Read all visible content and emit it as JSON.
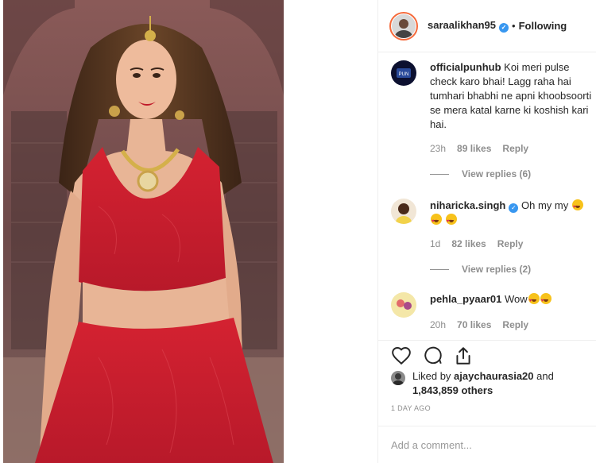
{
  "post": {
    "username": "saraalikhan95",
    "dot": "•",
    "follow_status": "Following"
  },
  "comments": [
    {
      "username": "officialpunhub",
      "text": "Koi meri pulse check karo bhai! Lagg raha hai tumhari bhabhi ne apni khoobsoorti se mera katal karne ki koshish kari hai.",
      "time": "23h",
      "likes": "89 likes",
      "reply": "Reply",
      "view_replies": "View replies (6)"
    },
    {
      "username": "niharicka.singh",
      "text": "Oh my my",
      "time": "1d",
      "likes": "82 likes",
      "reply": "Reply",
      "view_replies": "View replies (2)"
    },
    {
      "username": "pehla_pyaar01",
      "text": "Wow",
      "time": "20h",
      "likes": "70 likes",
      "reply": "Reply"
    }
  ],
  "likes": {
    "prefix": "Liked by ",
    "user": "ajaychaurasia20",
    "and": " and ",
    "count": "1,843,859 others"
  },
  "timestamp": "1 DAY AGO",
  "add_comment": {
    "placeholder": "Add a comment..."
  },
  "icons": {
    "like": "heart-outline-icon",
    "comment": "speech-bubble-icon",
    "share": "share-arrow-icon",
    "verified": "verified-badge-icon"
  },
  "colors": {
    "verified": "#3897f0",
    "muted": "#8e8e8e",
    "dress": "#c81e2c"
  }
}
